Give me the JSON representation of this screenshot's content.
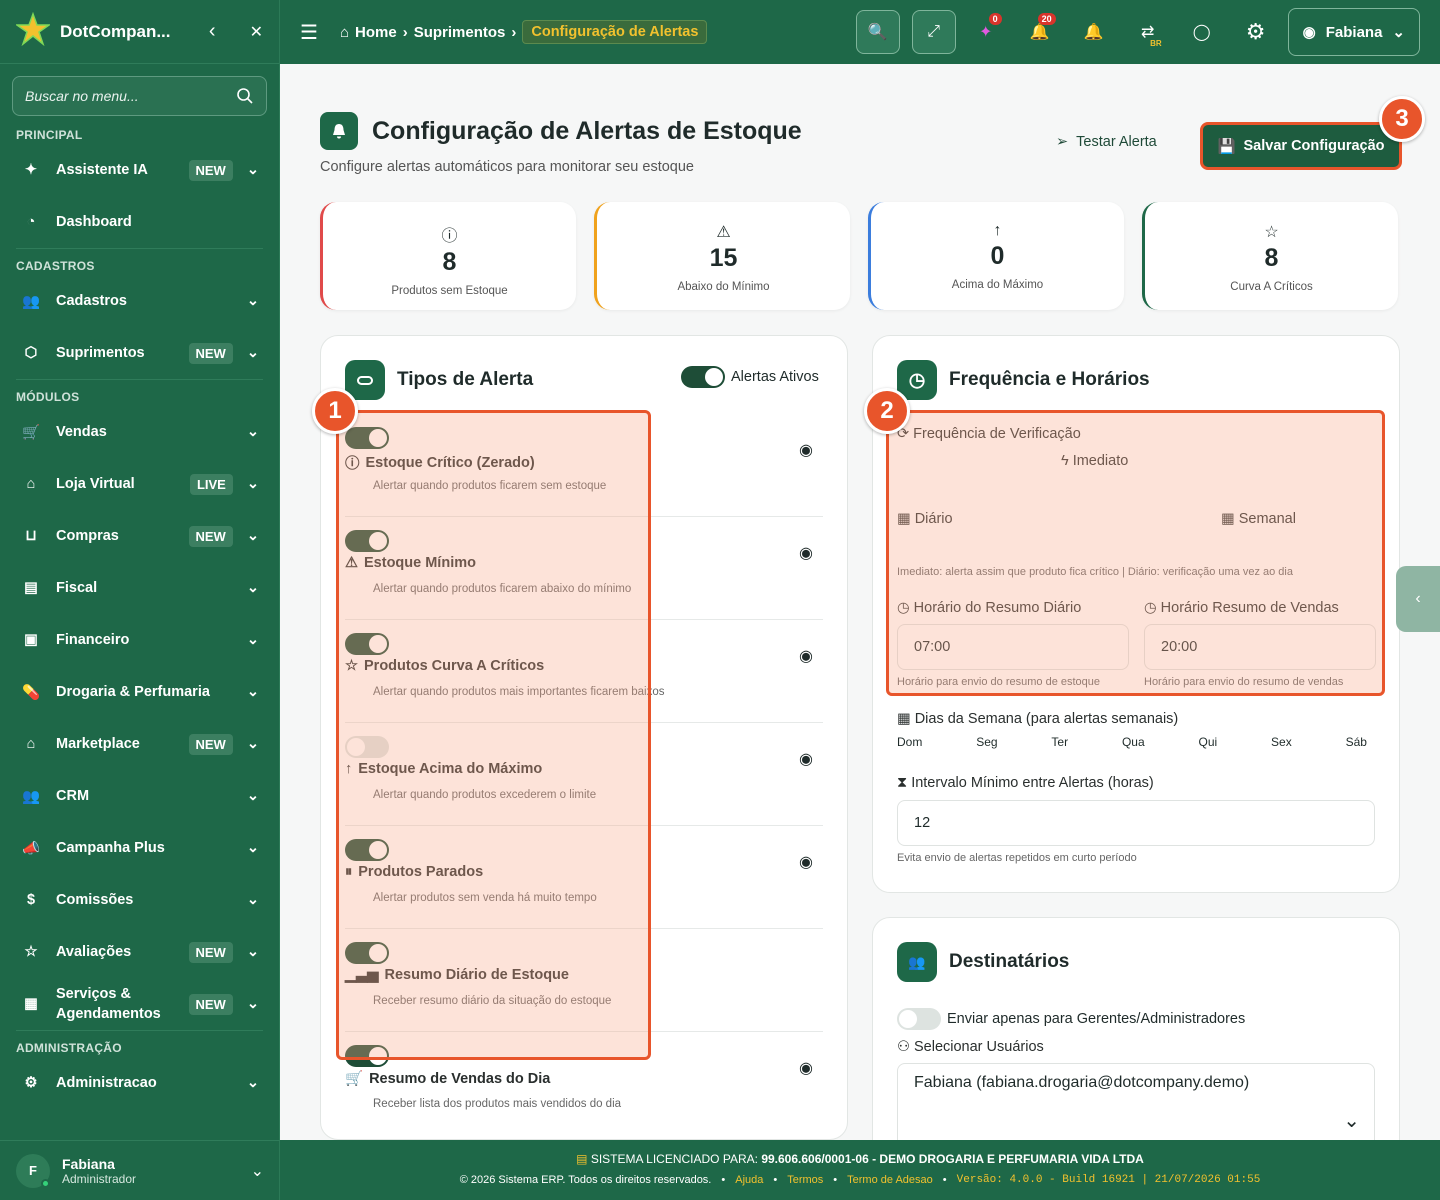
{
  "app": {
    "brand": "DotCompan...",
    "search_placeholder": "Buscar no menu..."
  },
  "sidebar": {
    "sections": [
      "PRINCIPAL",
      "CADASTROS",
      "MÓDULOS",
      "ADMINISTRAÇÃO"
    ],
    "items": [
      {
        "label": "Assistente IA",
        "badge": "NEW"
      },
      {
        "label": "Dashboard",
        "badge": ""
      },
      {
        "label": "Cadastros",
        "badge": ""
      },
      {
        "label": "Suprimentos",
        "badge": "NEW"
      },
      {
        "label": "Vendas",
        "badge": ""
      },
      {
        "label": "Loja Virtual",
        "badge": "LIVE"
      },
      {
        "label": "Compras",
        "badge": "NEW"
      },
      {
        "label": "Fiscal",
        "badge": ""
      },
      {
        "label": "Financeiro",
        "badge": ""
      },
      {
        "label": "Drogaria & Perfumaria",
        "badge": ""
      },
      {
        "label": "Marketplace",
        "badge": "NEW"
      },
      {
        "label": "CRM",
        "badge": ""
      },
      {
        "label": "Campanha Plus",
        "badge": ""
      },
      {
        "label": "Comissões",
        "badge": ""
      },
      {
        "label": "Avaliações",
        "badge": "NEW"
      },
      {
        "label": "Serviços & Agendamentos",
        "badge": "NEW"
      },
      {
        "label": "Administracao",
        "badge": ""
      }
    ],
    "user": {
      "initial": "F",
      "name": "Fabiana",
      "role": "Administrador"
    }
  },
  "topbar": {
    "home": "Home",
    "crumb1": "Suprimentos",
    "crumb_active": "Configuração de Alertas",
    "ai_count": "0",
    "notif_count": "20",
    "lang": "BR",
    "user": "Fabiana"
  },
  "page": {
    "title": "Configuração de Alertas de Estoque",
    "subtitle": "Configure alertas automáticos para monitorar seu estoque",
    "test_label": "Testar Alerta",
    "save_label": "Salvar Configuração"
  },
  "markers": [
    "1",
    "2",
    "3"
  ],
  "stats": [
    {
      "value": "8",
      "label": "Produtos sem Estoque",
      "color": "#e04a4a"
    },
    {
      "value": "15",
      "label": "Abaixo do Mínimo",
      "color": "#f0a21c"
    },
    {
      "value": "0",
      "label": "Acima do Máximo",
      "color": "#3b7ddd"
    },
    {
      "value": "8",
      "label": "Curva A Críticos",
      "color": "#1e6848"
    }
  ],
  "alert_types": {
    "title": "Tipos de Alerta",
    "master_label": "Alertas Ativos",
    "master_on": true,
    "items": [
      {
        "title": "Estoque Crítico (Zerado)",
        "desc": "Alertar quando produtos ficarem sem estoque",
        "on": true
      },
      {
        "title": "Estoque Mínimo",
        "desc": "Alertar quando produtos ficarem abaixo do mínimo",
        "on": true
      },
      {
        "title": "Produtos Curva A Críticos",
        "desc": "Alertar quando produtos mais importantes ficarem baixos",
        "on": true
      },
      {
        "title": "Estoque Acima do Máximo",
        "desc": "Alertar quando produtos excederem o limite",
        "on": false
      },
      {
        "title": "Produtos Parados",
        "desc": "Alertar produtos sem venda há muito tempo",
        "on": true
      },
      {
        "title": "Resumo Diário de Estoque",
        "desc": "Receber resumo diário da situação do estoque",
        "on": true
      },
      {
        "title": "Resumo de Vendas do Dia",
        "desc": "Receber lista dos produtos mais vendidos do dia",
        "on": true
      }
    ]
  },
  "frequency": {
    "title": "Frequência e Horários",
    "freq_label": "Frequência de Verificação",
    "options": [
      "Imediato",
      "Diário",
      "Semanal"
    ],
    "hint": "Imediato: alerta assim que produto fica crítico | Diário: verificação uma vez ao dia",
    "daily_label": "Horário do Resumo Diário",
    "daily_value": "07:00",
    "daily_help": "Horário para envio do resumo de estoque",
    "sales_label": "Horário Resumo de Vendas",
    "sales_value": "20:00",
    "sales_help": "Horário para envio do resumo de vendas",
    "days_label": "Dias da Semana (para alertas semanais)",
    "days": [
      "Dom",
      "Seg",
      "Ter",
      "Qua",
      "Qui",
      "Sex",
      "Sáb"
    ],
    "interval_label": "Intervalo Mínimo entre Alertas (horas)",
    "interval_value": "12",
    "interval_help": "Evita envio de alertas repetidos em curto período"
  },
  "recipients": {
    "title": "Destinatários",
    "managers_label": "Enviar apenas para Gerentes/Administradores",
    "select_label": "Selecionar Usuários",
    "selected": "Fabiana (fabiana.drogaria@dotcompany.demo)"
  },
  "footer": {
    "license_prefix": "SISTEMA LICENCIADO PARA:",
    "license": "99.606.606/0001-06 - DEMO DROGARIA E PERFUMARIA VIDA LTDA",
    "copyright": "© 2026 Sistema ERP. Todos os direitos reservados.",
    "links": [
      "Ajuda",
      "Termos",
      "Termo de Adesao"
    ],
    "version": "Versão: 4.0.0 - Build 16921 | 21/07/2026 01:55"
  }
}
